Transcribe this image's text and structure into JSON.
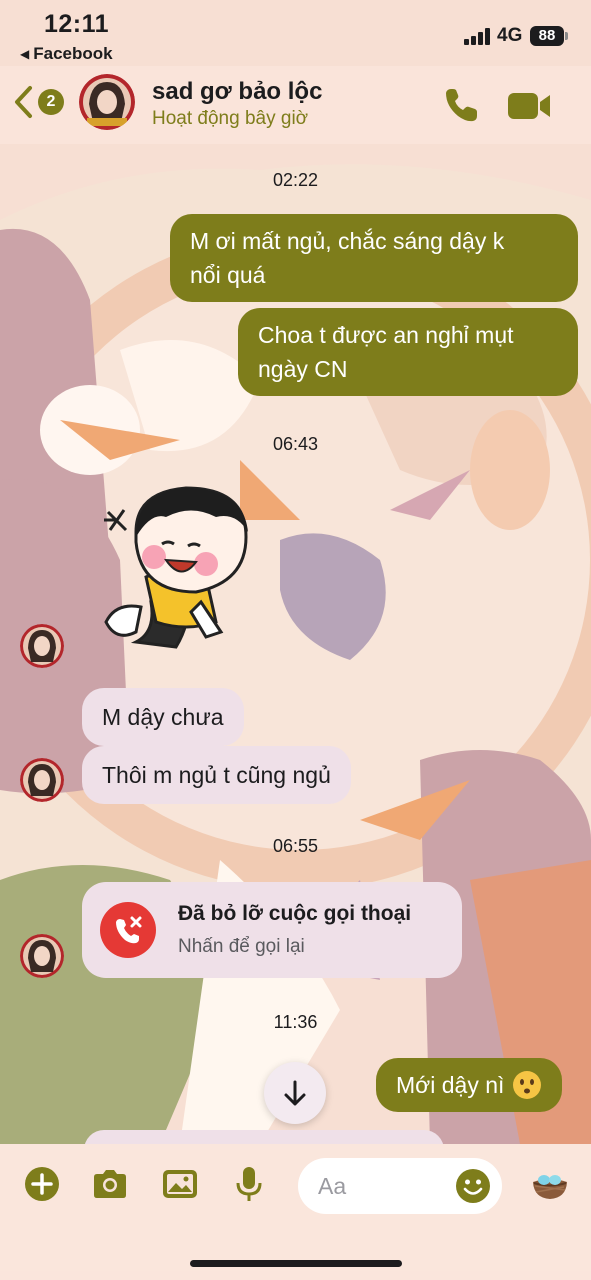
{
  "status_bar": {
    "time": "12:11",
    "back_app": "Facebook",
    "network": "4G",
    "battery": "88"
  },
  "header": {
    "unread_count": "2",
    "contact_name": "sad gơ bảo lộc",
    "contact_status": "Hoạt động bây giờ"
  },
  "conversation": {
    "timestamps": [
      "02:22",
      "06:43",
      "06:55",
      "11:36"
    ],
    "outgoing": [
      {
        "line1": "M ơi mất ngủ, chắc sáng dậy k",
        "line2": "nổi quá"
      },
      {
        "line1": "Choa t được an nghỉ mụt",
        "line2": "ngày CN"
      },
      {
        "text": "Mới dậy nì"
      }
    ],
    "incoming": [
      {
        "text": "M dậy chưa"
      },
      {
        "text": "Thôi m ngủ t cũng ngủ"
      }
    ],
    "missed_call": {
      "title": "Đã bỏ lỡ cuộc gọi thoại",
      "subtitle": "Nhấn để gọi lại"
    }
  },
  "composer": {
    "placeholder": "Aa"
  },
  "colors": {
    "accent": "#7e7d1b",
    "incoming_bubble": "#efe0e8",
    "missed_red": "#e53935",
    "background": "#f7dfd3"
  },
  "icons": [
    "chevron-left-icon",
    "phone-icon",
    "video-camera-icon",
    "plus-icon",
    "camera-icon",
    "image-icon",
    "microphone-icon",
    "smile-icon",
    "nest-icon",
    "arrow-down-icon",
    "missed-call-icon"
  ]
}
